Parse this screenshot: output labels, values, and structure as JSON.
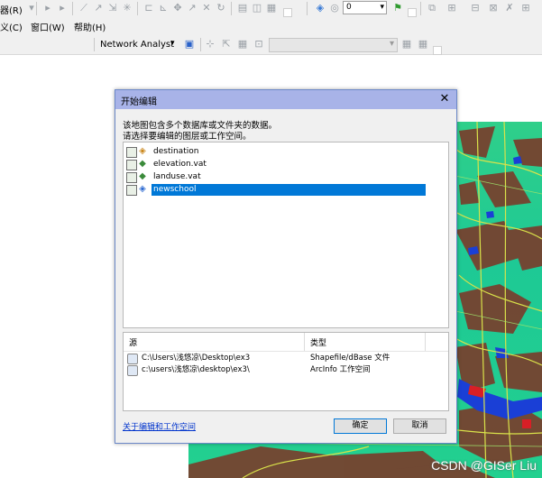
{
  "menubar": {
    "row1_partial": "器(R)",
    "row2_items": [
      "义(C)",
      "窗口(W)",
      "帮助(H)"
    ],
    "toolbar_label": "Network Analyst"
  },
  "georef_dropdown": {
    "value": "0"
  },
  "dialog": {
    "title": "开始编辑",
    "description_line1": "该地图包含多个数据库或文件夹的数据。",
    "description_line2": "请选择要编辑的图层或工作空间。",
    "layers": [
      {
        "label": "destination",
        "icon": "point-layer-icon",
        "selected": false
      },
      {
        "label": "elevation.vat",
        "icon": "table-icon",
        "selected": false
      },
      {
        "label": "landuse.vat",
        "icon": "table-icon",
        "selected": false
      },
      {
        "label": "newschool",
        "icon": "point-layer-icon",
        "selected": true
      }
    ],
    "sources_header": {
      "source": "源",
      "type": "类型"
    },
    "sources": [
      {
        "path": "C:\\Users\\浅悠凉\\Desktop\\ex3",
        "type": "Shapefile/dBase 文件"
      },
      {
        "path": "c:\\users\\浅悠凉\\desktop\\ex3\\",
        "type": "ArcInfo 工作空间"
      }
    ],
    "help_link": "关于编辑和工作空间",
    "ok_label": "确定",
    "cancel_label": "取消"
  },
  "watermark": "CSDN @GISer Liu",
  "colors": {
    "dialog_title_bg": "#a8b3e8",
    "selection": "#0078d7",
    "map_green": "#22d08f",
    "map_brown": "#7a3b2a",
    "river_blue": "#1a3fd6",
    "road_yellow": "#d9e24a"
  }
}
